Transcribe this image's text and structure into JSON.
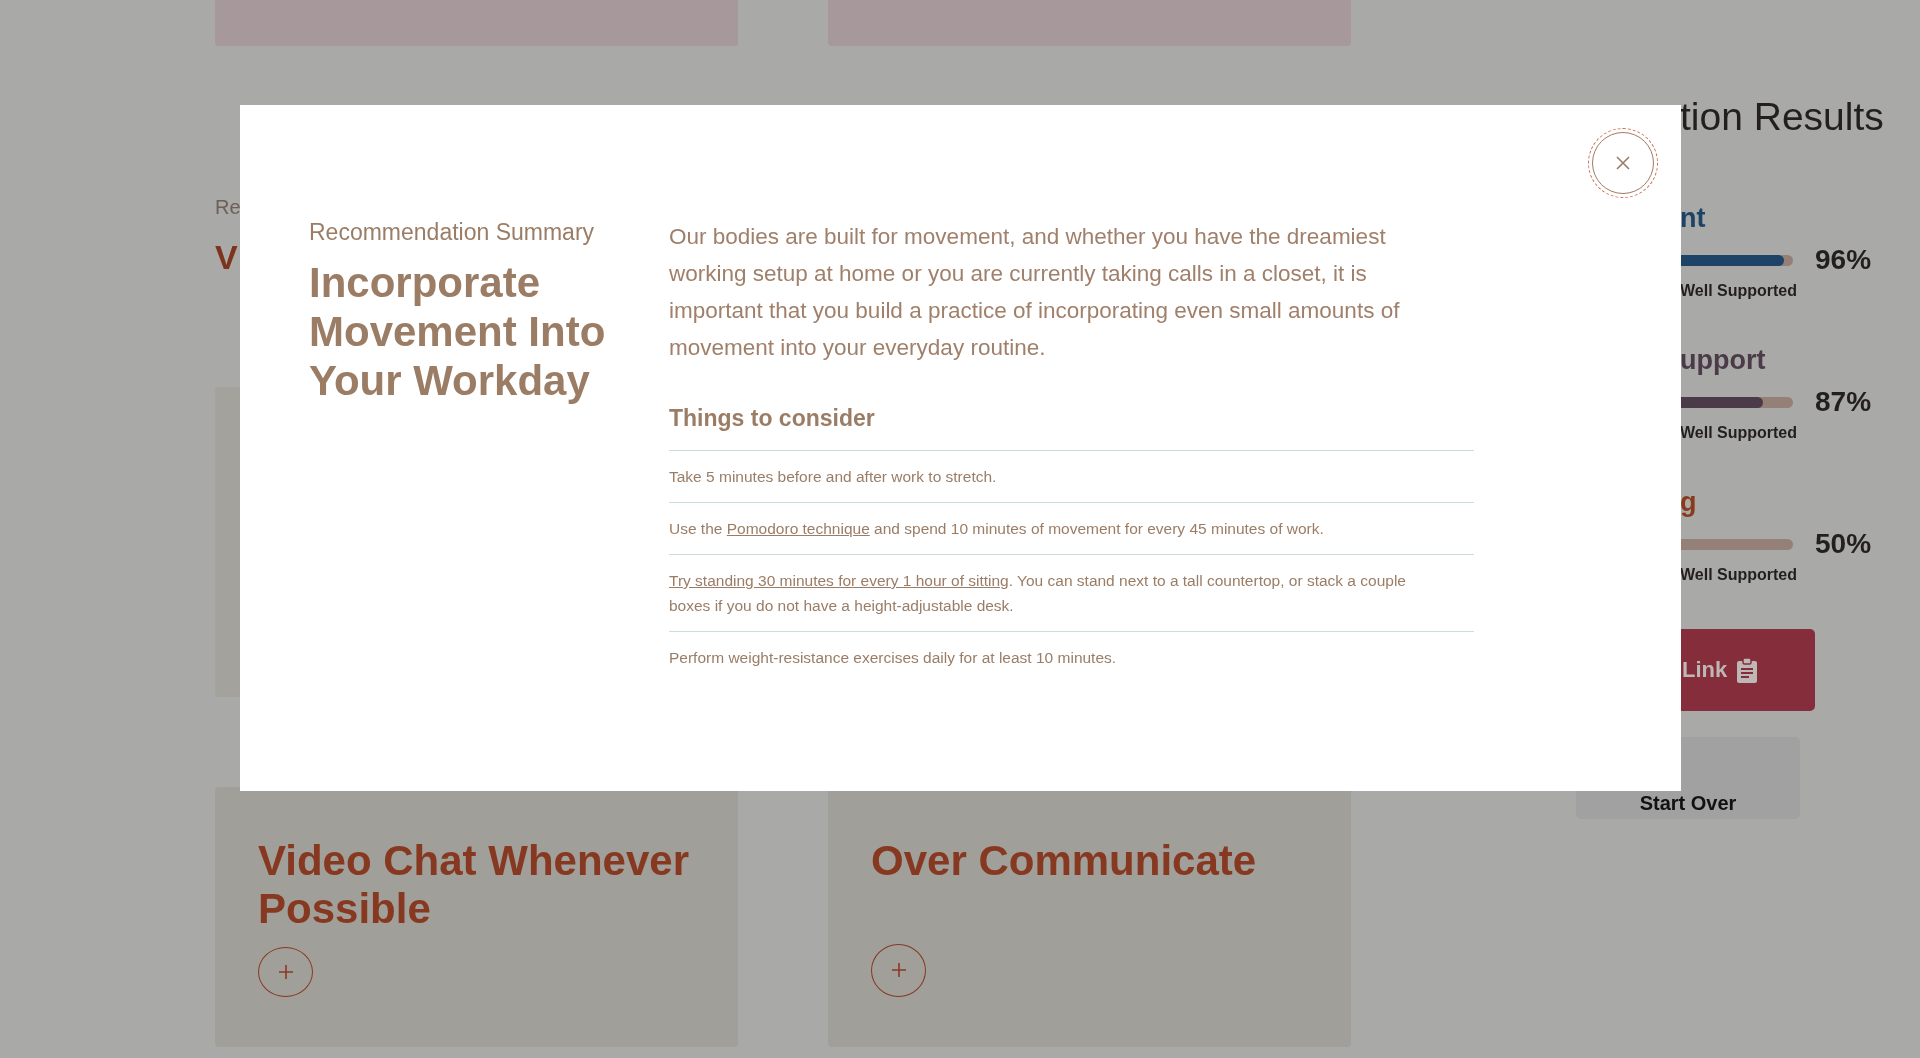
{
  "background": {
    "intro_label": "Re",
    "intro_title": "V",
    "cards": [
      {
        "title": "Video Chat Whenever Possible"
      },
      {
        "title": "Over Communicate"
      }
    ]
  },
  "sidebar": {
    "heading": "tion Results",
    "results": [
      {
        "title": "nt",
        "color": "#1d4466",
        "level": 0.96,
        "percent": "96%",
        "label": "Well Supported"
      },
      {
        "title": "upport",
        "color": "#4b3b48",
        "level": 0.87,
        "percent": "87%",
        "label": "Well Supported"
      },
      {
        "title": "g",
        "color": "#8a3a1c",
        "percent": "50%",
        "label": "Well Supported"
      }
    ],
    "link_button": "Link",
    "start_over_button": "Start Over"
  },
  "modal": {
    "eyebrow": "Recommendation Summary",
    "title": "Incorporate Movement Into Your Workday",
    "body": "Our bodies are built for movement, and whether you have the dreamiest working setup at home or you are currently taking calls in a closet, it is important that you build a practice of incorporating even small amounts of movement into your everyday routine.",
    "list_heading": "Things to consider",
    "items": [
      {
        "parts": [
          {
            "text": "Take 5 minutes before and after work to stretch.",
            "link": false
          }
        ]
      },
      {
        "parts": [
          {
            "text": "Use the ",
            "link": false
          },
          {
            "text": "Pomodoro technique",
            "link": true
          },
          {
            "text": " and spend 10 minutes of movement for every 45 minutes of work.",
            "link": false
          }
        ]
      },
      {
        "parts": [
          {
            "text": "Try standing 30 minutes for every 1 hour of sitting",
            "link": true
          },
          {
            "text": ". You can stand next to a tall countertop, or stack a couple boxes if you do not have a height-adjustable desk.",
            "link": false
          }
        ]
      },
      {
        "parts": [
          {
            "text": "Perform weight-resistance exercises daily for at least 10 minutes.",
            "link": false
          }
        ]
      }
    ]
  }
}
